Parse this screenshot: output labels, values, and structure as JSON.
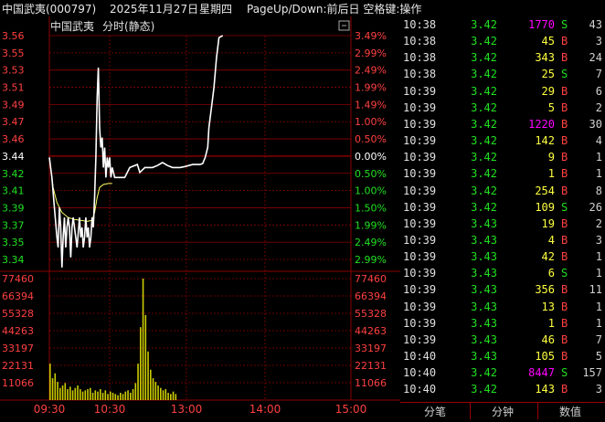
{
  "header": {
    "stock": "中国武夷(000797)",
    "date": "2025年11月27日",
    "weekday": "星期四",
    "hint": "PageUp/Down:前后日 空格键:操作"
  },
  "chart_header": {
    "name": "中国武夷",
    "mode": "分时(静态)"
  },
  "colors": {
    "up": "#ff4040",
    "down": "#20e020",
    "flat": "#ffffff",
    "grid": "#8b0000",
    "price_line": "#ffffff",
    "avg_line": "#ffff66",
    "volume": "#cccc00",
    "time": "#e0e0e0",
    "buy": "#ff4040",
    "sell": "#20e020",
    "big_volume": "#ff00ff",
    "normal_volume": "#ffff40"
  },
  "chart_data": {
    "type": "line",
    "x_ticks": [
      "09:30",
      "10:30",
      "13:00",
      "14:00",
      "15:00"
    ],
    "price_ticks": [
      "3.56",
      "3.55",
      "3.53",
      "3.51",
      "3.49",
      "3.47",
      "3.46",
      "3.44",
      "3.42",
      "3.41",
      "3.39",
      "3.37",
      "3.35",
      "3.34"
    ],
    "pct_ticks": [
      "3.49%",
      "2.99%",
      "2.49%",
      "1.99%",
      "1.49%",
      "1.00%",
      "0.50%",
      "0.00%",
      "0.50%",
      "1.00%",
      "1.50%",
      "1.99%",
      "2.49%",
      "2.99%"
    ],
    "pct_colors": [
      "up",
      "up",
      "up",
      "up",
      "up",
      "up",
      "up",
      "flat",
      "down",
      "down",
      "down",
      "down",
      "down",
      "down"
    ],
    "price_colors": [
      "up",
      "up",
      "up",
      "up",
      "up",
      "up",
      "up",
      "flat",
      "down",
      "down",
      "down",
      "down",
      "down",
      "down"
    ],
    "volume_ticks": [
      "77460",
      "66394",
      "55328",
      "44263",
      "33197",
      "22131",
      "11066"
    ],
    "price_range": [
      3.338,
      3.562
    ],
    "volume_max": 77460,
    "minutes_total": 240,
    "price_series": [
      [
        0,
        3.44
      ],
      [
        2,
        3.42
      ],
      [
        4,
        3.39
      ],
      [
        6,
        3.36
      ],
      [
        7,
        3.35
      ],
      [
        8,
        3.39
      ],
      [
        9,
        3.37
      ],
      [
        10,
        3.33
      ],
      [
        11,
        3.36
      ],
      [
        12,
        3.38
      ],
      [
        13,
        3.35
      ],
      [
        14,
        3.37
      ],
      [
        15,
        3.38
      ],
      [
        16,
        3.37
      ],
      [
        17,
        3.34
      ],
      [
        18,
        3.37
      ],
      [
        19,
        3.38
      ],
      [
        20,
        3.37
      ],
      [
        22,
        3.35
      ],
      [
        24,
        3.38
      ],
      [
        25,
        3.36
      ],
      [
        26,
        3.37
      ],
      [
        27,
        3.35
      ],
      [
        28,
        3.36
      ],
      [
        29,
        3.38
      ],
      [
        30,
        3.36
      ],
      [
        31,
        3.37
      ],
      [
        32,
        3.35
      ],
      [
        33,
        3.36
      ],
      [
        34,
        3.38
      ],
      [
        35,
        3.37
      ],
      [
        36,
        3.4
      ],
      [
        37,
        3.44
      ],
      [
        38,
        3.5
      ],
      [
        39,
        3.53
      ],
      [
        40,
        3.47
      ],
      [
        41,
        3.45
      ],
      [
        42,
        3.46
      ],
      [
        43,
        3.43
      ],
      [
        44,
        3.45
      ],
      [
        45,
        3.42
      ],
      [
        46,
        3.44
      ],
      [
        47,
        3.43
      ],
      [
        48,
        3.44
      ],
      [
        49,
        3.42
      ],
      [
        50,
        3.43
      ],
      [
        52,
        3.42
      ],
      [
        55,
        3.42
      ],
      [
        60,
        3.42
      ],
      [
        64,
        3.43
      ],
      [
        70,
        3.433
      ],
      [
        72,
        3.425
      ],
      [
        76,
        3.43
      ],
      [
        82,
        3.43
      ],
      [
        86,
        3.432
      ],
      [
        90,
        3.435
      ],
      [
        94,
        3.432
      ],
      [
        98,
        3.43
      ],
      [
        104,
        3.43
      ],
      [
        108,
        3.431
      ],
      [
        114,
        3.433
      ],
      [
        118,
        3.433
      ],
      [
        120,
        3.433
      ],
      [
        122,
        3.434
      ],
      [
        124,
        3.44
      ],
      [
        126,
        3.45
      ],
      [
        127,
        3.47
      ],
      [
        129,
        3.49
      ],
      [
        131,
        3.51
      ],
      [
        133,
        3.54
      ],
      [
        135,
        3.56
      ],
      [
        138,
        3.562
      ]
    ],
    "avg_series": [
      [
        0,
        3.44
      ],
      [
        3,
        3.41
      ],
      [
        6,
        3.395
      ],
      [
        10,
        3.385
      ],
      [
        15,
        3.38
      ],
      [
        20,
        3.378
      ],
      [
        25,
        3.377
      ],
      [
        30,
        3.376
      ],
      [
        34,
        3.377
      ],
      [
        36,
        3.385
      ],
      [
        38,
        3.4
      ],
      [
        40,
        3.41
      ],
      [
        43,
        3.413
      ],
      [
        47,
        3.414
      ],
      [
        50,
        3.414
      ]
    ],
    "volumes": [
      30,
      18,
      22,
      15,
      10,
      12,
      14,
      9,
      11,
      8,
      10,
      12,
      9,
      7,
      8,
      9,
      10,
      6,
      8,
      7,
      9,
      6,
      8,
      5,
      7,
      6,
      5,
      4,
      6,
      5,
      7,
      8,
      6,
      9,
      14,
      30,
      60,
      100,
      70,
      40,
      25,
      18,
      15,
      12,
      10,
      8,
      9,
      6,
      5,
      7,
      5
    ]
  },
  "trades": [
    {
      "time": "10:38",
      "price": "3.42",
      "vol": "1770",
      "side": "S",
      "cnt": "43",
      "vol_color": "big_volume"
    },
    {
      "time": "10:38",
      "price": "3.42",
      "vol": "45",
      "side": "B",
      "cnt": "3",
      "vol_color": "normal_volume"
    },
    {
      "time": "10:38",
      "price": "3.42",
      "vol": "343",
      "side": "B",
      "cnt": "24",
      "vol_color": "normal_volume"
    },
    {
      "time": "10:38",
      "price": "3.42",
      "vol": "25",
      "side": "S",
      "cnt": "7",
      "vol_color": "normal_volume"
    },
    {
      "time": "10:39",
      "price": "3.42",
      "vol": "29",
      "side": "B",
      "cnt": "6",
      "vol_color": "normal_volume"
    },
    {
      "time": "10:39",
      "price": "3.42",
      "vol": "5",
      "side": "B",
      "cnt": "2",
      "vol_color": "normal_volume"
    },
    {
      "time": "10:39",
      "price": "3.42",
      "vol": "1220",
      "side": "B",
      "cnt": "30",
      "vol_color": "big_volume"
    },
    {
      "time": "10:39",
      "price": "3.42",
      "vol": "142",
      "side": "B",
      "cnt": "4",
      "vol_color": "normal_volume"
    },
    {
      "time": "10:39",
      "price": "3.42",
      "vol": "9",
      "side": "B",
      "cnt": "1",
      "vol_color": "normal_volume"
    },
    {
      "time": "10:39",
      "price": "3.42",
      "vol": "1",
      "side": "B",
      "cnt": "1",
      "vol_color": "normal_volume"
    },
    {
      "time": "10:39",
      "price": "3.42",
      "vol": "254",
      "side": "B",
      "cnt": "8",
      "vol_color": "normal_volume"
    },
    {
      "time": "10:39",
      "price": "3.42",
      "vol": "109",
      "side": "S",
      "cnt": "26",
      "vol_color": "normal_volume"
    },
    {
      "time": "10:39",
      "price": "3.43",
      "vol": "19",
      "side": "B",
      "cnt": "2",
      "vol_color": "normal_volume"
    },
    {
      "time": "10:39",
      "price": "3.43",
      "vol": "4",
      "side": "B",
      "cnt": "3",
      "vol_color": "normal_volume"
    },
    {
      "time": "10:39",
      "price": "3.43",
      "vol": "42",
      "side": "B",
      "cnt": "1",
      "vol_color": "normal_volume"
    },
    {
      "time": "10:39",
      "price": "3.43",
      "vol": "6",
      "side": "S",
      "cnt": "1",
      "vol_color": "normal_volume"
    },
    {
      "time": "10:39",
      "price": "3.43",
      "vol": "356",
      "side": "B",
      "cnt": "11",
      "vol_color": "normal_volume"
    },
    {
      "time": "10:39",
      "price": "3.43",
      "vol": "13",
      "side": "B",
      "cnt": "1",
      "vol_color": "normal_volume"
    },
    {
      "time": "10:39",
      "price": "3.43",
      "vol": "1",
      "side": "B",
      "cnt": "1",
      "vol_color": "normal_volume"
    },
    {
      "time": "10:39",
      "price": "3.43",
      "vol": "46",
      "side": "B",
      "cnt": "7",
      "vol_color": "normal_volume"
    },
    {
      "time": "10:40",
      "price": "3.43",
      "vol": "105",
      "side": "B",
      "cnt": "5",
      "vol_color": "normal_volume"
    },
    {
      "time": "10:40",
      "price": "3.42",
      "vol": "8447",
      "side": "S",
      "cnt": "157",
      "vol_color": "big_volume"
    },
    {
      "time": "10:40",
      "price": "3.42",
      "vol": "143",
      "side": "B",
      "cnt": "3",
      "vol_color": "normal_volume"
    }
  ],
  "tabs": [
    "分笔",
    "分钟",
    "数值"
  ]
}
